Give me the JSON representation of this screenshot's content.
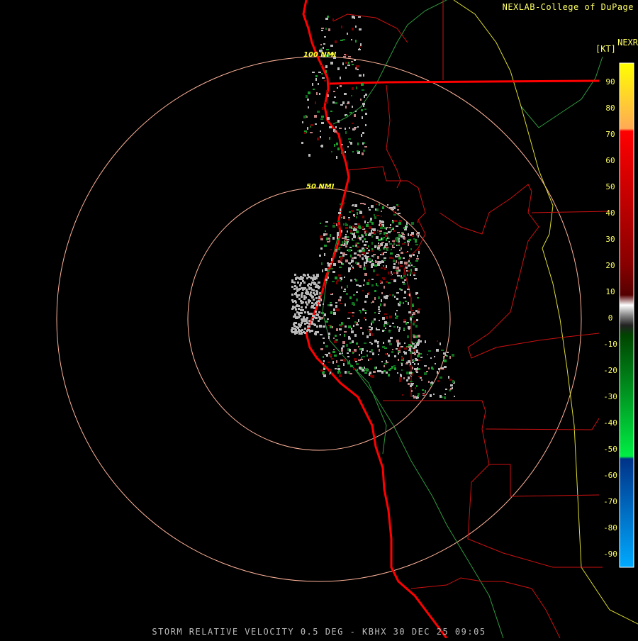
{
  "header": {
    "credit": "NEXLAB-College of DuPage",
    "product": "NEXR",
    "units": "[KT]"
  },
  "footer": {
    "caption": "STORM RELATIVE VELOCITY 0.5 DEG - KBHX 30 DEC 25 09:05"
  },
  "range_rings": [
    {
      "label": "50 NMI"
    },
    {
      "label": "100 NMI"
    }
  ],
  "legend": {
    "ticks": [
      "90",
      "80",
      "70",
      "60",
      "50",
      "40",
      "30",
      "20",
      "10",
      "0",
      "-10",
      "-20",
      "-30",
      "-40",
      "-50",
      "-60",
      "-70",
      "-80",
      "-90"
    ],
    "colors": {
      "inbound_strong": "#0077ff",
      "inbound": "#00cc33",
      "near_zero": "#aaaaaa",
      "outbound": "#880000",
      "outbound_strong": "#ff0000",
      "max": "#ffff00"
    }
  },
  "map_colors": {
    "coastline": "#ff0000",
    "county_lines": "#cc0000",
    "rivers": "#33aa44",
    "range_rings": "#ffb39a",
    "yellow_boundary": "#dddd33"
  }
}
